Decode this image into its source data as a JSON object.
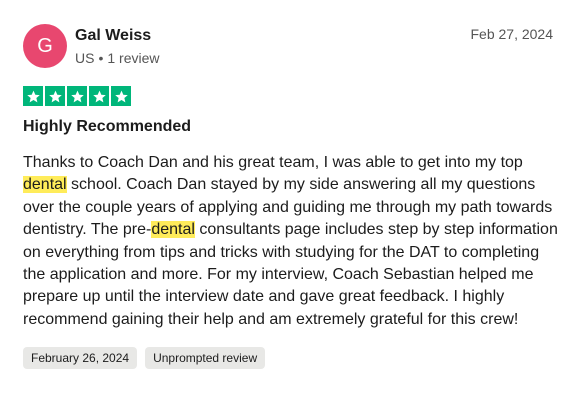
{
  "reviewer": {
    "initial": "G",
    "name": "Gal Weiss",
    "country": "US",
    "separator": "•",
    "review_count": "1 review",
    "avatar_color": "#e8476f"
  },
  "review": {
    "date": "Feb 27, 2024",
    "rating": 5,
    "rating_max": 5,
    "star_color": "#00b67a",
    "title": "Highly Recommended",
    "body": [
      {
        "text": "Thanks to Coach Dan and his great team, I was able to get into my top ",
        "highlight": false
      },
      {
        "text": "dental",
        "highlight": true
      },
      {
        "text": " school. Coach Dan stayed by my side answering all my questions over the couple years of applying and guiding me through my path towards dentistry. The pre-",
        "highlight": false
      },
      {
        "text": "dental",
        "highlight": true
      },
      {
        "text": " consultants page includes step by step information on everything from tips and tricks with studying for the DAT to completing the application and more. For my interview, Coach Sebastian helped me prepare up until the interview date and gave great feedback. I highly recommend gaining their help and am extremely grateful for this crew!",
        "highlight": false
      }
    ],
    "highlight_color": "#ffec5a",
    "tags": [
      "February 26, 2024",
      "Unprompted review"
    ]
  }
}
